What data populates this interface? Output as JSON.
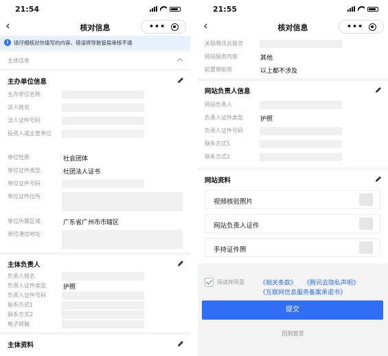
{
  "left": {
    "status_time": "21:54",
    "nav_title": "核对信息",
    "notice": "请仔细核对你填写的内容，错误将导致管局审核不通",
    "collapse_label": "主体信息",
    "org_section": {
      "title": "主办单位信息",
      "rows": [
        {
          "label": "主办单位名称",
          "value": ""
        },
        {
          "label": "法人姓名",
          "value": ""
        },
        {
          "label": "法人证件号码",
          "value": ""
        },
        {
          "label": "投资人或主管单位",
          "value": ""
        },
        {
          "label": "单位性质",
          "value": "社会团体"
        },
        {
          "label": "单位证件类型",
          "value": "社团法人证书"
        },
        {
          "label": "单位证件号码",
          "value": ""
        },
        {
          "label": "单位证件住所",
          "value": ""
        },
        {
          "label": "单位所属区域",
          "value": "广东省广州市市辖区"
        },
        {
          "label": "单位通信地址",
          "value": ""
        }
      ]
    },
    "principal_section": {
      "title": "主体负责人",
      "rows": [
        {
          "label": "负责人姓名",
          "value": ""
        },
        {
          "label": "负责人证件类型",
          "value": "护照"
        },
        {
          "label": "负责人证件号码",
          "value": ""
        },
        {
          "label": "联系方式1",
          "value": ""
        },
        {
          "label": "联系方式2",
          "value": ""
        },
        {
          "label": "电子邮箱",
          "value": ""
        }
      ]
    },
    "materials_section": {
      "title": "主体资料"
    }
  },
  "right": {
    "status_time": "21:55",
    "nav_title": "核对信息",
    "top_rows": [
      {
        "label": "关联腾讯云服务",
        "value": ""
      },
      {
        "label": "网站服务内容",
        "value": "其他"
      },
      {
        "label": "前置审批项",
        "value": "以上都不涉及"
      }
    ],
    "site_principal": {
      "title": "网站负责人信息",
      "rows": [
        {
          "label": "网站负责人",
          "value": ""
        },
        {
          "label": "负责人证件类型",
          "value": "护照"
        },
        {
          "label": "负责人证件号码",
          "value": ""
        },
        {
          "label": "联系方式1",
          "value": ""
        },
        {
          "label": "联系方式2",
          "value": ""
        }
      ]
    },
    "site_materials": {
      "title": "网站资料",
      "items": [
        "视频核验照片",
        "网站负责人证件",
        "手持证件照"
      ]
    },
    "agreement": {
      "prefix": "阅读并同意",
      "link1": "《相关条款》",
      "link2": "《腾讯云隐私声明》",
      "link3": "《互联网信息服务备案承诺书》"
    },
    "submit_label": "提交",
    "back_home_label": "回到首页"
  },
  "colors": {
    "accent": "#2f6ef5",
    "notice_bg": "#e7f0fd",
    "check": "#2aa44f"
  }
}
